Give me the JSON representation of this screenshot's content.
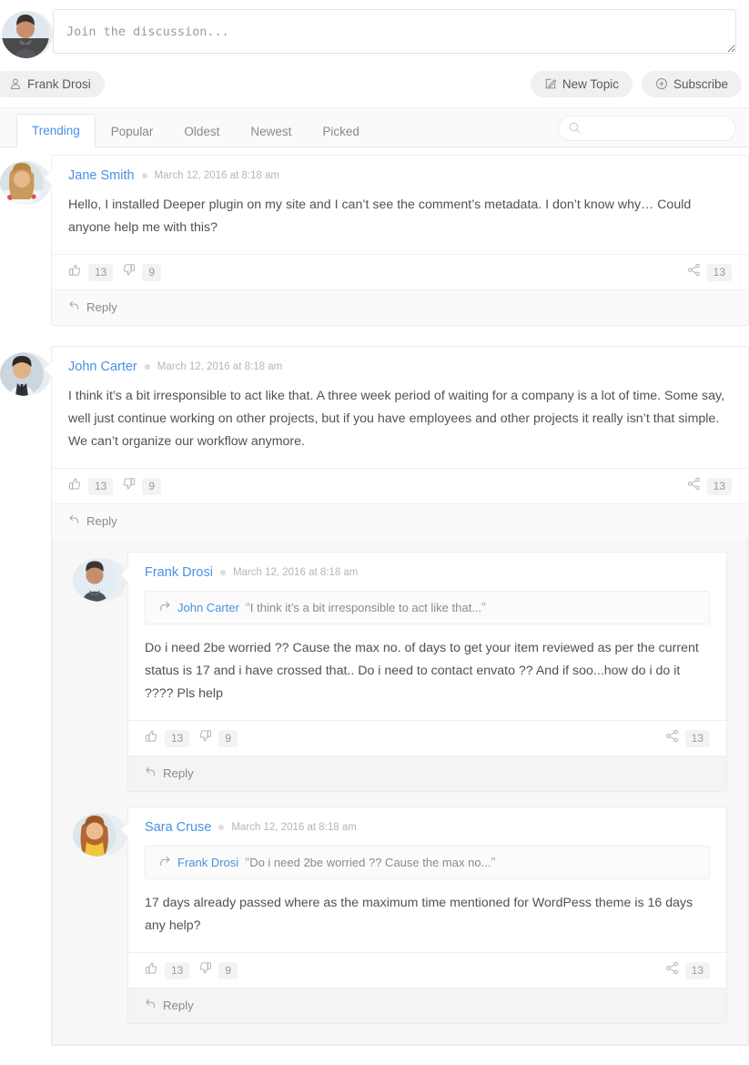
{
  "compose": {
    "placeholder": "Join the discussion...",
    "value": "",
    "avatar_name": "frank-drosi-avatar"
  },
  "actionbar": {
    "user_label": "Frank Drosi",
    "user_icon": "user-icon",
    "new_topic_label": "New Topic",
    "new_topic_icon": "pencil-square-icon",
    "subscribe_label": "Subscribe",
    "subscribe_icon": "plus-circle-icon"
  },
  "tabs": [
    {
      "label": "Trending",
      "active": true
    },
    {
      "label": "Popular",
      "active": false
    },
    {
      "label": "Oldest",
      "active": false
    },
    {
      "label": "Newest",
      "active": false
    },
    {
      "label": "Picked",
      "active": false
    }
  ],
  "search": {
    "placeholder": "",
    "value": "",
    "icon": "search-icon"
  },
  "labels": {
    "reply": "Reply",
    "like_icon": "thumbs-up-icon",
    "dislike_icon": "thumbs-down-icon",
    "share_icon": "share-icon",
    "reply_icon": "reply-arrow-icon",
    "quote_icon": "quote-reply-arrow-icon"
  },
  "colors": {
    "link": "#4a90e2",
    "text": "#4f5255",
    "muted": "#b6b6b6",
    "panel": "#f7f7f7",
    "border": "#ececec"
  },
  "comments": [
    {
      "id": "c1",
      "author": "Jane Smith",
      "date": "March 12, 2016 at 8:18 am",
      "body": "Hello, I installed Deeper plugin on my site and I can’t see the comment’s metadata. I don’t know why… Could anyone help me with this?",
      "likes": "13",
      "dislikes": "9",
      "shares": "13",
      "reply_label": "Reply"
    },
    {
      "id": "c2",
      "author": "John Carter",
      "date": "March 12, 2016 at 8:18 am",
      "body": "I think it’s a bit irresponsible to act like that. A three week period of waiting for a company is a lot of time. Some say, well just continue working on other projects, but if you have employees and other projects it really isn’t that simple. We can’t organize our workflow anymore.",
      "likes": "13",
      "dislikes": "9",
      "shares": "13",
      "reply_label": "Reply",
      "children": [
        {
          "id": "c2r1",
          "author": "Frank Drosi",
          "date": "March 12, 2016 at 8:18 am",
          "quote_author": "John Carter",
          "quote_text": "I think it’s a bit irresponsible to act like that...",
          "body": "Do i need 2be worried ?? Cause the max no. of days to get your item reviewed as per the current status is 17 and i have crossed that.. Do i need to contact envato ?? And if soo...how do i do it ???? Pls help",
          "likes": "13",
          "dislikes": "9",
          "shares": "13",
          "reply_label": "Reply"
        },
        {
          "id": "c2r2",
          "author": "Sara Cruse",
          "date": "March 12, 2016 at 8:18 am",
          "quote_author": "Frank Drosi",
          "quote_text": "Do i need 2be worried ?? Cause the max no...",
          "body": "17 days already passed where as the maximum time mentioned for WordPess theme is 16 days any help?",
          "likes": "13",
          "dislikes": "9",
          "shares": "13",
          "reply_label": "Reply"
        }
      ]
    }
  ]
}
